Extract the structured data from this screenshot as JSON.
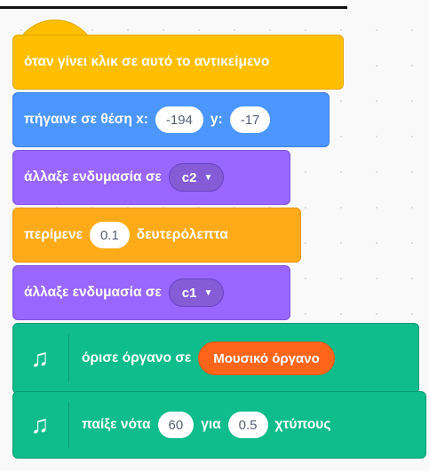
{
  "blocks": {
    "when_clicked": "όταν γίνει κλικ σε αυτό το αντικείμενο",
    "goto": {
      "label": "πήγαινε σε θέση x:",
      "x": "-194",
      "ylabel": "y:",
      "y": "-17"
    },
    "costume1": {
      "label": "άλλαξε ενδυμασία σε",
      "value": "c2"
    },
    "wait": {
      "label": "περίμενε",
      "value": "0.1",
      "unit": "δευτερόλεπτα"
    },
    "costume2": {
      "label": "άλλαξε ενδυμασία σε",
      "value": "c1"
    },
    "set_instrument": {
      "label": "όρισε όργανο σε",
      "value": "Μουσικό όργανο"
    },
    "play_note": {
      "label": "παίξε νότα",
      "note": "60",
      "for": "για",
      "beats": "0.5",
      "unit": "χτύπους"
    }
  },
  "icons": {
    "music": "music-notes-icon",
    "dropdown": "caret-down-icon"
  },
  "colors": {
    "events": "#ffbf00",
    "motion": "#4c97ff",
    "looks": "#9966ff",
    "control": "#ffab19",
    "music": "#0fbd8c",
    "instrument_menu": "#ff661a"
  }
}
